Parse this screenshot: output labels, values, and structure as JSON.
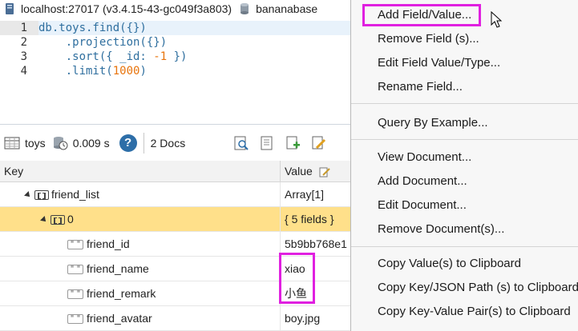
{
  "titlebar": {
    "connection": "localhost:27017 (v3.4.15-43-gc049f3a803)",
    "database": "bananabase"
  },
  "editor": {
    "line_numbers": [
      "1",
      "2",
      "3",
      "4"
    ],
    "line1": "db.toys.find({})",
    "line2": "    .projection({})",
    "line3_pre": "    .sort({ _id: ",
    "line3_num": "-1",
    "line3_post": " })",
    "line4_pre": "    .limit(",
    "line4_num": "1000",
    "line4_post": ")"
  },
  "toolbar": {
    "collection": "toys",
    "time": "0.009 s",
    "help": "?",
    "docs": "2 Docs"
  },
  "table": {
    "col_key": "Key",
    "col_value": "Value",
    "rows": [
      {
        "key": "friend_list",
        "value": "Array[1]",
        "type": "array"
      },
      {
        "key": "0",
        "value": "{ 5 fields }",
        "type": "object"
      },
      {
        "key": "friend_id",
        "value": "5b9bb768e1",
        "type": "string"
      },
      {
        "key": "friend_name",
        "value": "xiao",
        "type": "string"
      },
      {
        "key": "friend_remark",
        "value": "小鱼",
        "type": "string"
      },
      {
        "key": "friend_avatar",
        "value": "boy.jpg",
        "type": "string"
      }
    ]
  },
  "context_menu": {
    "items": [
      "Add Field/Value...",
      "Remove Field (s)...",
      "Edit Field Value/Type...",
      "Rename Field...",
      "Query By Example...",
      "View Document...",
      "Add Document...",
      "Edit Document...",
      "Remove Document(s)...",
      "Copy Value(s)  to Clipboard",
      "Copy Key/JSON Path (s) to Clipboard",
      "Copy Key-Value Pair(s) to Clipboard"
    ]
  },
  "colors": {
    "highlight": "#e020e0",
    "selected_row": "#ffe08a",
    "code_blue": "#2f6f9f",
    "code_number": "#e8740c"
  }
}
